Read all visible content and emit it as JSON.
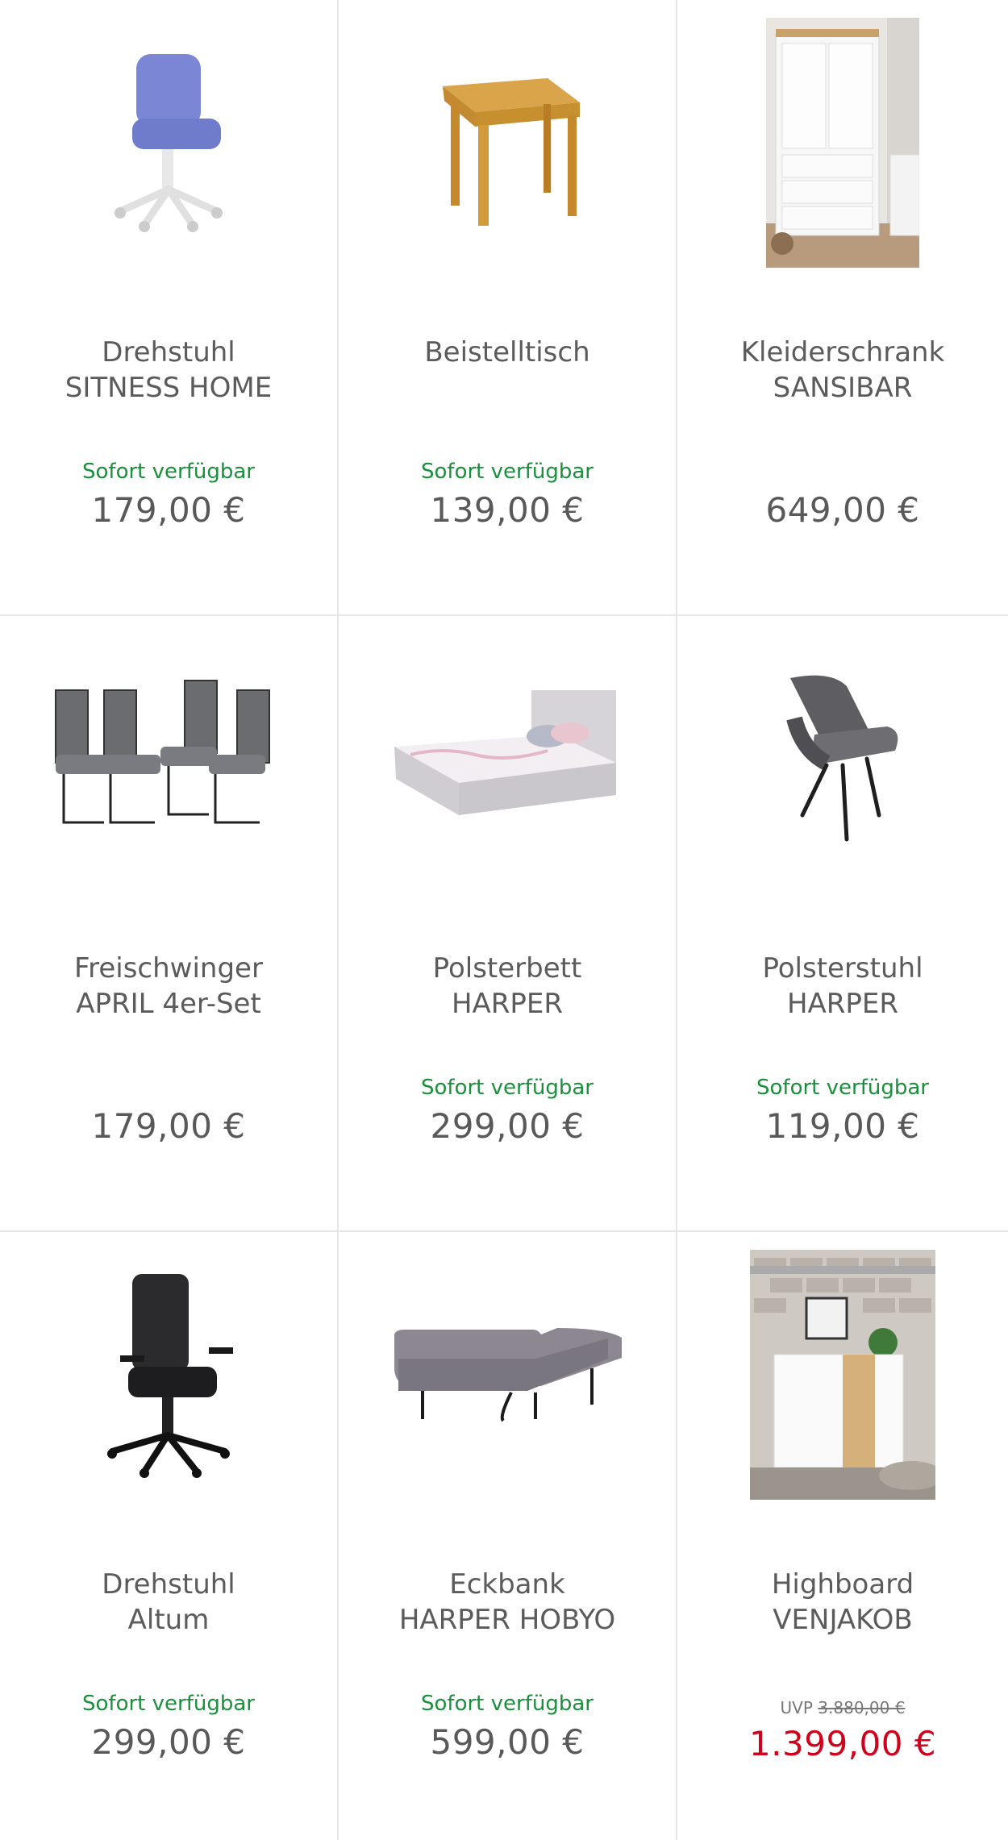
{
  "products": [
    {
      "title_line1": "Drehstuhl",
      "title_line2": "SITNESS HOME",
      "availability": "Sofort verfügbar",
      "price": "179,00 €",
      "image": "swivel-chair-blue-image"
    },
    {
      "title_line1": "Beistelltisch",
      "title_line2": "",
      "availability": "Sofort verfügbar",
      "price": "139,00 €",
      "image": "side-table-wood-image"
    },
    {
      "title_line1": "Kleiderschrank",
      "title_line2": "SANSIBAR",
      "availability": "",
      "price": "649,00 €",
      "image": "wardrobe-white-image"
    },
    {
      "title_line1": "Freischwinger",
      "title_line2": "APRIL 4er-Set",
      "availability": "",
      "price": "179,00 €",
      "image": "cantilever-chairs-set-image"
    },
    {
      "title_line1": "Polsterbett",
      "title_line2": "HARPER",
      "availability": "Sofort verfügbar",
      "price": "299,00 €",
      "image": "upholstered-bed-image"
    },
    {
      "title_line1": "Polsterstuhl",
      "title_line2": "HARPER",
      "availability": "Sofort verfügbar",
      "price": "119,00 €",
      "image": "upholstered-chair-image"
    },
    {
      "title_line1": "Drehstuhl",
      "title_line2": "Altum",
      "availability": "Sofort verfügbar",
      "price": "299,00 €",
      "image": "office-chair-black-image"
    },
    {
      "title_line1": "Eckbank",
      "title_line2": "HARPER HOBYO",
      "availability": "Sofort verfügbar",
      "price": "599,00 €",
      "image": "corner-bench-image"
    },
    {
      "title_line1": "Highboard",
      "title_line2": "VENJAKOB",
      "availability": "",
      "uvp_label": "UVP",
      "uvp_price": "3.880,00 €",
      "price": "1.399,00 €",
      "image": "highboard-image"
    }
  ],
  "colors": {
    "availability": "#1a8f3c",
    "sale_price": "#d0021b",
    "divider": "#e6e6e6"
  }
}
